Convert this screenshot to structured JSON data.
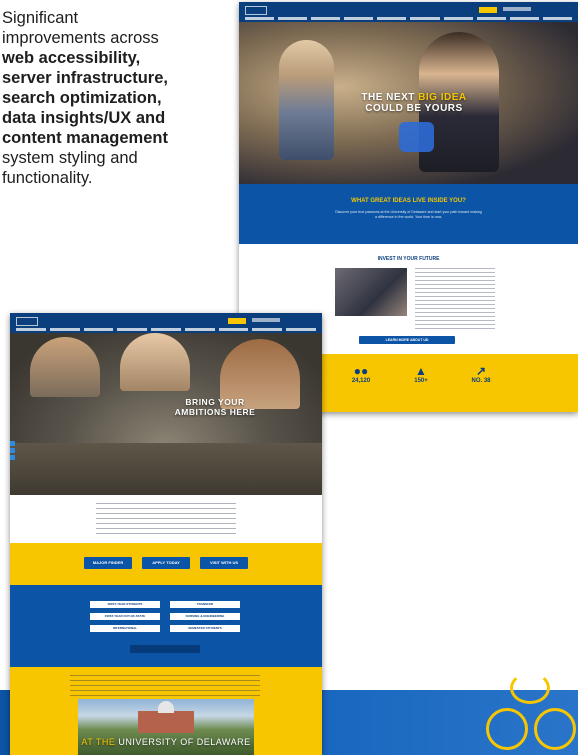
{
  "intro": {
    "line1": "Significant",
    "line2": "improvements across",
    "line3": "web accessibility,",
    "line4": "server infrastructure,",
    "line5": "search optimization,",
    "line6": "data insights/UX and",
    "line7": "content management",
    "line8": "system styling and",
    "line9": "functionality."
  },
  "shot1": {
    "hero_line1_a": "THE NEXT ",
    "hero_line1_b": "BIG IDEA",
    "hero_line2": "COULD BE YOURS",
    "band_title": "WHAT GREAT IDEAS LIVE INSIDE YOU?",
    "band_text": "Discover your true passions at the University of Delaware and start your path toward making a difference in the world. Your time is now.",
    "invest_title": "INVEST IN YOUR FUTURE",
    "cta": "LEARN MORE ABOUT UD",
    "stat1": "24,120",
    "stat2": "150+",
    "stat3": "NO. 38"
  },
  "shot2": {
    "hero_line1": "BRING YOUR",
    "hero_line2": "AMBITIONS HERE",
    "btn1": "MAJOR FINDER",
    "btn2": "APPLY TODAY",
    "btn3": "VISIT WITH US",
    "link1": "FIRST-YEAR STUDENTS",
    "link2": "TRANSFER",
    "link3": "FIRST-YEAR OUT-OF-STATE",
    "link4": "NURSING & ENGINEERING",
    "link5": "INTERNATIONAL",
    "link6": "SEMESTER STUDENTS",
    "footer_a": "AT THE ",
    "footer_b": "UNIVERSITY OF DELAWARE"
  },
  "colors": {
    "ud_blue": "#0b54a6",
    "ud_gold": "#f7c600",
    "ud_navy": "#0a3e7c"
  }
}
